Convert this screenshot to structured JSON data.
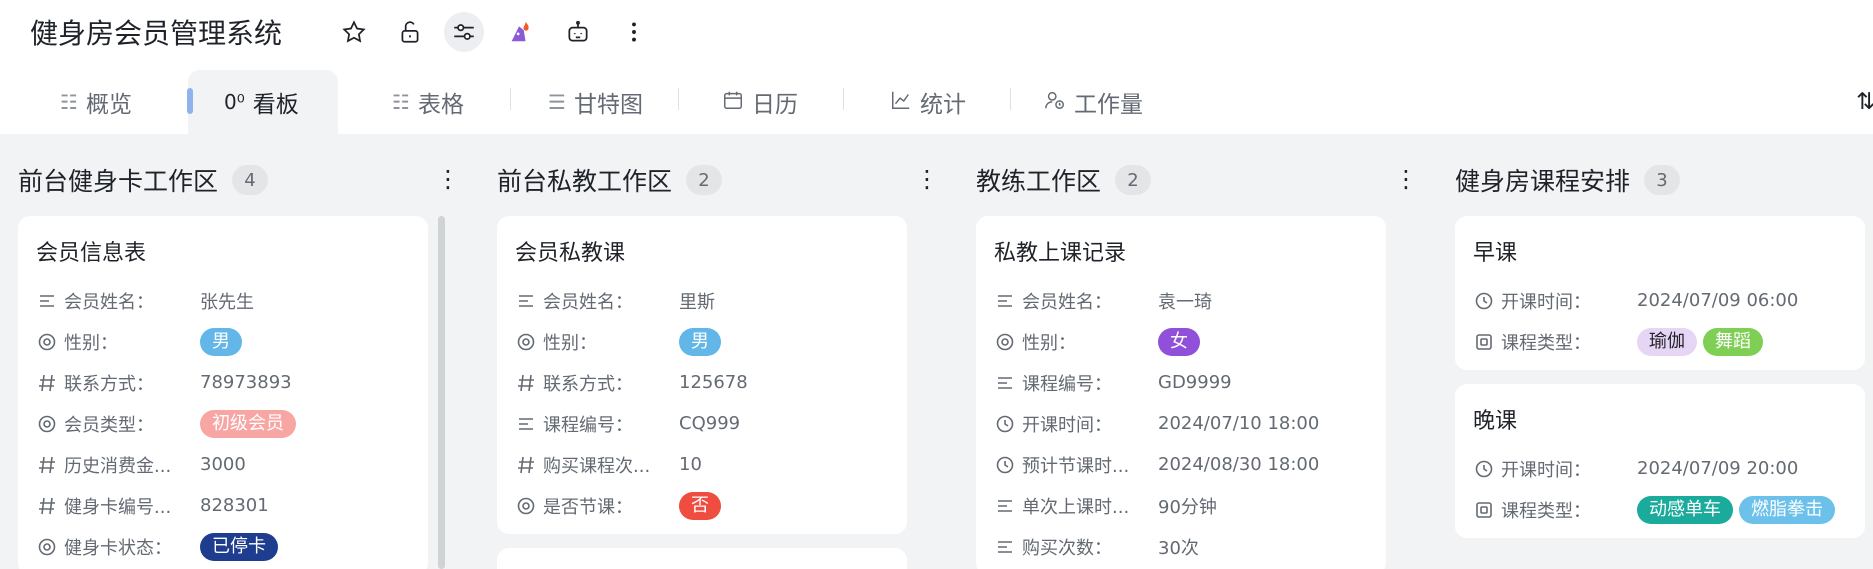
{
  "app": {
    "title": "健身房会员管理系统"
  },
  "toolbar": {
    "icons": [
      "star-icon",
      "unlock-icon",
      "sliders-icon",
      "wizard-hat-icon",
      "robot-icon",
      "more-icon"
    ]
  },
  "tabs": [
    {
      "label": "概览",
      "icon": "list-icon"
    },
    {
      "label": "看板",
      "icon": "kanban-icon"
    },
    {
      "label": "表格",
      "icon": "list-icon"
    },
    {
      "label": "甘特图",
      "icon": "gantt-icon"
    },
    {
      "label": "日历",
      "icon": "calendar-icon"
    },
    {
      "label": "统计",
      "icon": "chart-icon"
    },
    {
      "label": "工作量",
      "icon": "user-workload-icon"
    }
  ],
  "active_tab": "看板",
  "columns": [
    {
      "name": "前台健身卡工作区",
      "count": "4",
      "cards": [
        {
          "title": "会员信息表",
          "fields": [
            {
              "icon": "text",
              "label": "会员姓名：",
              "value": "张先生"
            },
            {
              "icon": "option",
              "label": "性别：",
              "tags": [
                {
                  "text": "男",
                  "bg": "#62b6e8",
                  "fg": "#ffffff"
                }
              ]
            },
            {
              "icon": "number",
              "label": "联系方式：",
              "value": "78973893"
            },
            {
              "icon": "option",
              "label": "会员类型：",
              "tags": [
                {
                  "text": "初级会员",
                  "bg": "#f7a6a3",
                  "fg": "#ffffff"
                }
              ]
            },
            {
              "icon": "number",
              "label": "历史消费金...",
              "value": "3000"
            },
            {
              "icon": "number",
              "label": "健身卡编号...",
              "value": "828301"
            },
            {
              "icon": "option",
              "label": "健身卡状态：",
              "tags": [
                {
                  "text": "已停卡",
                  "bg": "#1f3d8f",
                  "fg": "#ffffff"
                }
              ]
            }
          ]
        }
      ]
    },
    {
      "name": "前台私教工作区",
      "count": "2",
      "cards": [
        {
          "title": "会员私教课",
          "fields": [
            {
              "icon": "text",
              "label": "会员姓名：",
              "value": "里斯"
            },
            {
              "icon": "option",
              "label": "性别：",
              "tags": [
                {
                  "text": "男",
                  "bg": "#62b6e8",
                  "fg": "#ffffff"
                }
              ]
            },
            {
              "icon": "number",
              "label": "联系方式：",
              "value": "125678"
            },
            {
              "icon": "text",
              "label": "课程编号：",
              "value": "CQ999"
            },
            {
              "icon": "number",
              "label": "购买课程次...",
              "value": "10"
            },
            {
              "icon": "option",
              "label": "是否节课：",
              "tags": [
                {
                  "text": "否",
                  "bg": "#ee4d3f",
                  "fg": "#ffffff"
                }
              ]
            }
          ]
        }
      ]
    },
    {
      "name": "教练工作区",
      "count": "2",
      "cards": [
        {
          "title": "私教上课记录",
          "fields": [
            {
              "icon": "text",
              "label": "会员姓名：",
              "value": "袁一琦"
            },
            {
              "icon": "option",
              "label": "性别：",
              "tags": [
                {
                  "text": "女",
                  "bg": "#9150d9",
                  "fg": "#ffffff"
                }
              ]
            },
            {
              "icon": "text",
              "label": "课程编号：",
              "value": "GD9999"
            },
            {
              "icon": "clock",
              "label": "开课时间：",
              "value": "2024/07/10 18:00"
            },
            {
              "icon": "clock",
              "label": "预计节课时...",
              "value": "2024/08/30 18:00"
            },
            {
              "icon": "text",
              "label": "单次上课时...",
              "value": "90分钟"
            },
            {
              "icon": "text",
              "label": "购买次数：",
              "value": "30次"
            }
          ]
        }
      ]
    },
    {
      "name": "健身房课程安排",
      "count": "3",
      "cards": [
        {
          "title": "早课",
          "fields": [
            {
              "icon": "clock",
              "label": "开课时间：",
              "value": "2024/07/09 06:00"
            },
            {
              "icon": "multi",
              "label": "课程类型：",
              "tags": [
                {
                  "text": "瑜伽",
                  "bg": "#e7d5f5",
                  "fg": "#1f2329"
                },
                {
                  "text": "舞蹈",
                  "bg": "#7fcf55",
                  "fg": "#ffffff"
                }
              ]
            }
          ]
        },
        {
          "title": "晚课",
          "fields": [
            {
              "icon": "clock",
              "label": "开课时间：",
              "value": "2024/07/09 20:00"
            },
            {
              "icon": "multi",
              "label": "课程类型：",
              "tags": [
                {
                  "text": "动感单车",
                  "bg": "#1aab9c",
                  "fg": "#ffffff"
                },
                {
                  "text": "燃脂拳击",
                  "bg": "#6bc1ea",
                  "fg": "#ffffff"
                }
              ]
            }
          ]
        }
      ]
    }
  ]
}
